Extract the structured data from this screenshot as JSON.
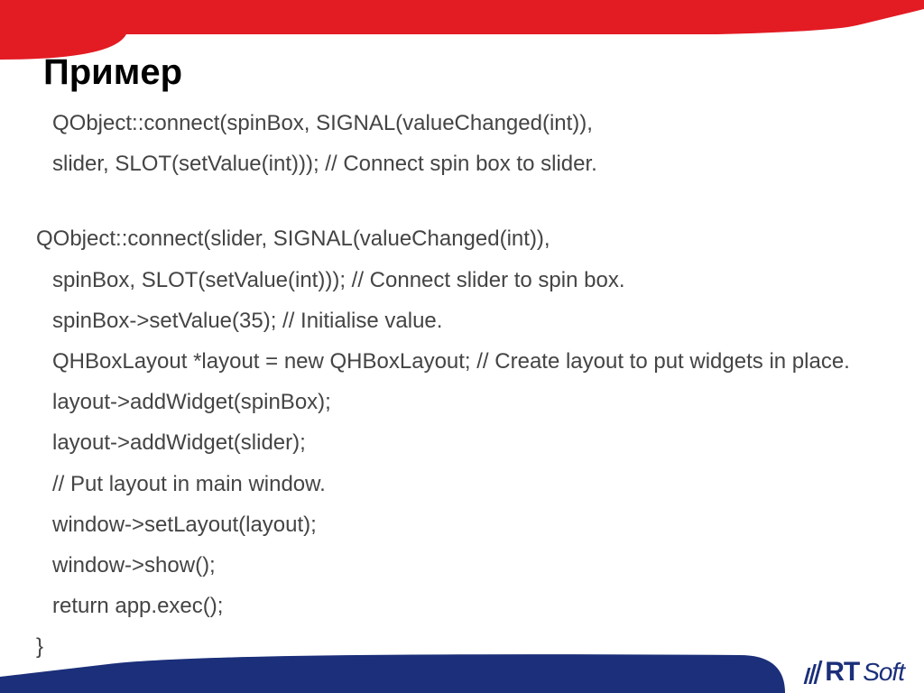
{
  "title": "Пример",
  "code": {
    "l0": "QObject::connect(spinBox, SIGNAL(valueChanged(int)),",
    "l1": "slider, SLOT(setValue(int))); // Connect spin box to slider.",
    "l2": "QObject::connect(slider, SIGNAL(valueChanged(int)),",
    "l3": " spinBox, SLOT(setValue(int))); // Connect slider to spin box.",
    "l4": " spinBox->setValue(35);  // Initialise value.",
    "l5": " QHBoxLayout *layout = new QHBoxLayout; // Create layout to put widgets in place.",
    "l6": " layout->addWidget(spinBox);",
    "l7": " layout->addWidget(slider);",
    "l8": " // Put layout in main window.",
    "l9": " window->setLayout(layout);",
    "l10": " window->show();",
    "l11": " return app.exec();",
    "l12": "}"
  },
  "logo": {
    "brand1": "RT",
    "brand2": "Soft"
  },
  "colors": {
    "red": "#e31b23",
    "blue": "#1b2f7a"
  }
}
